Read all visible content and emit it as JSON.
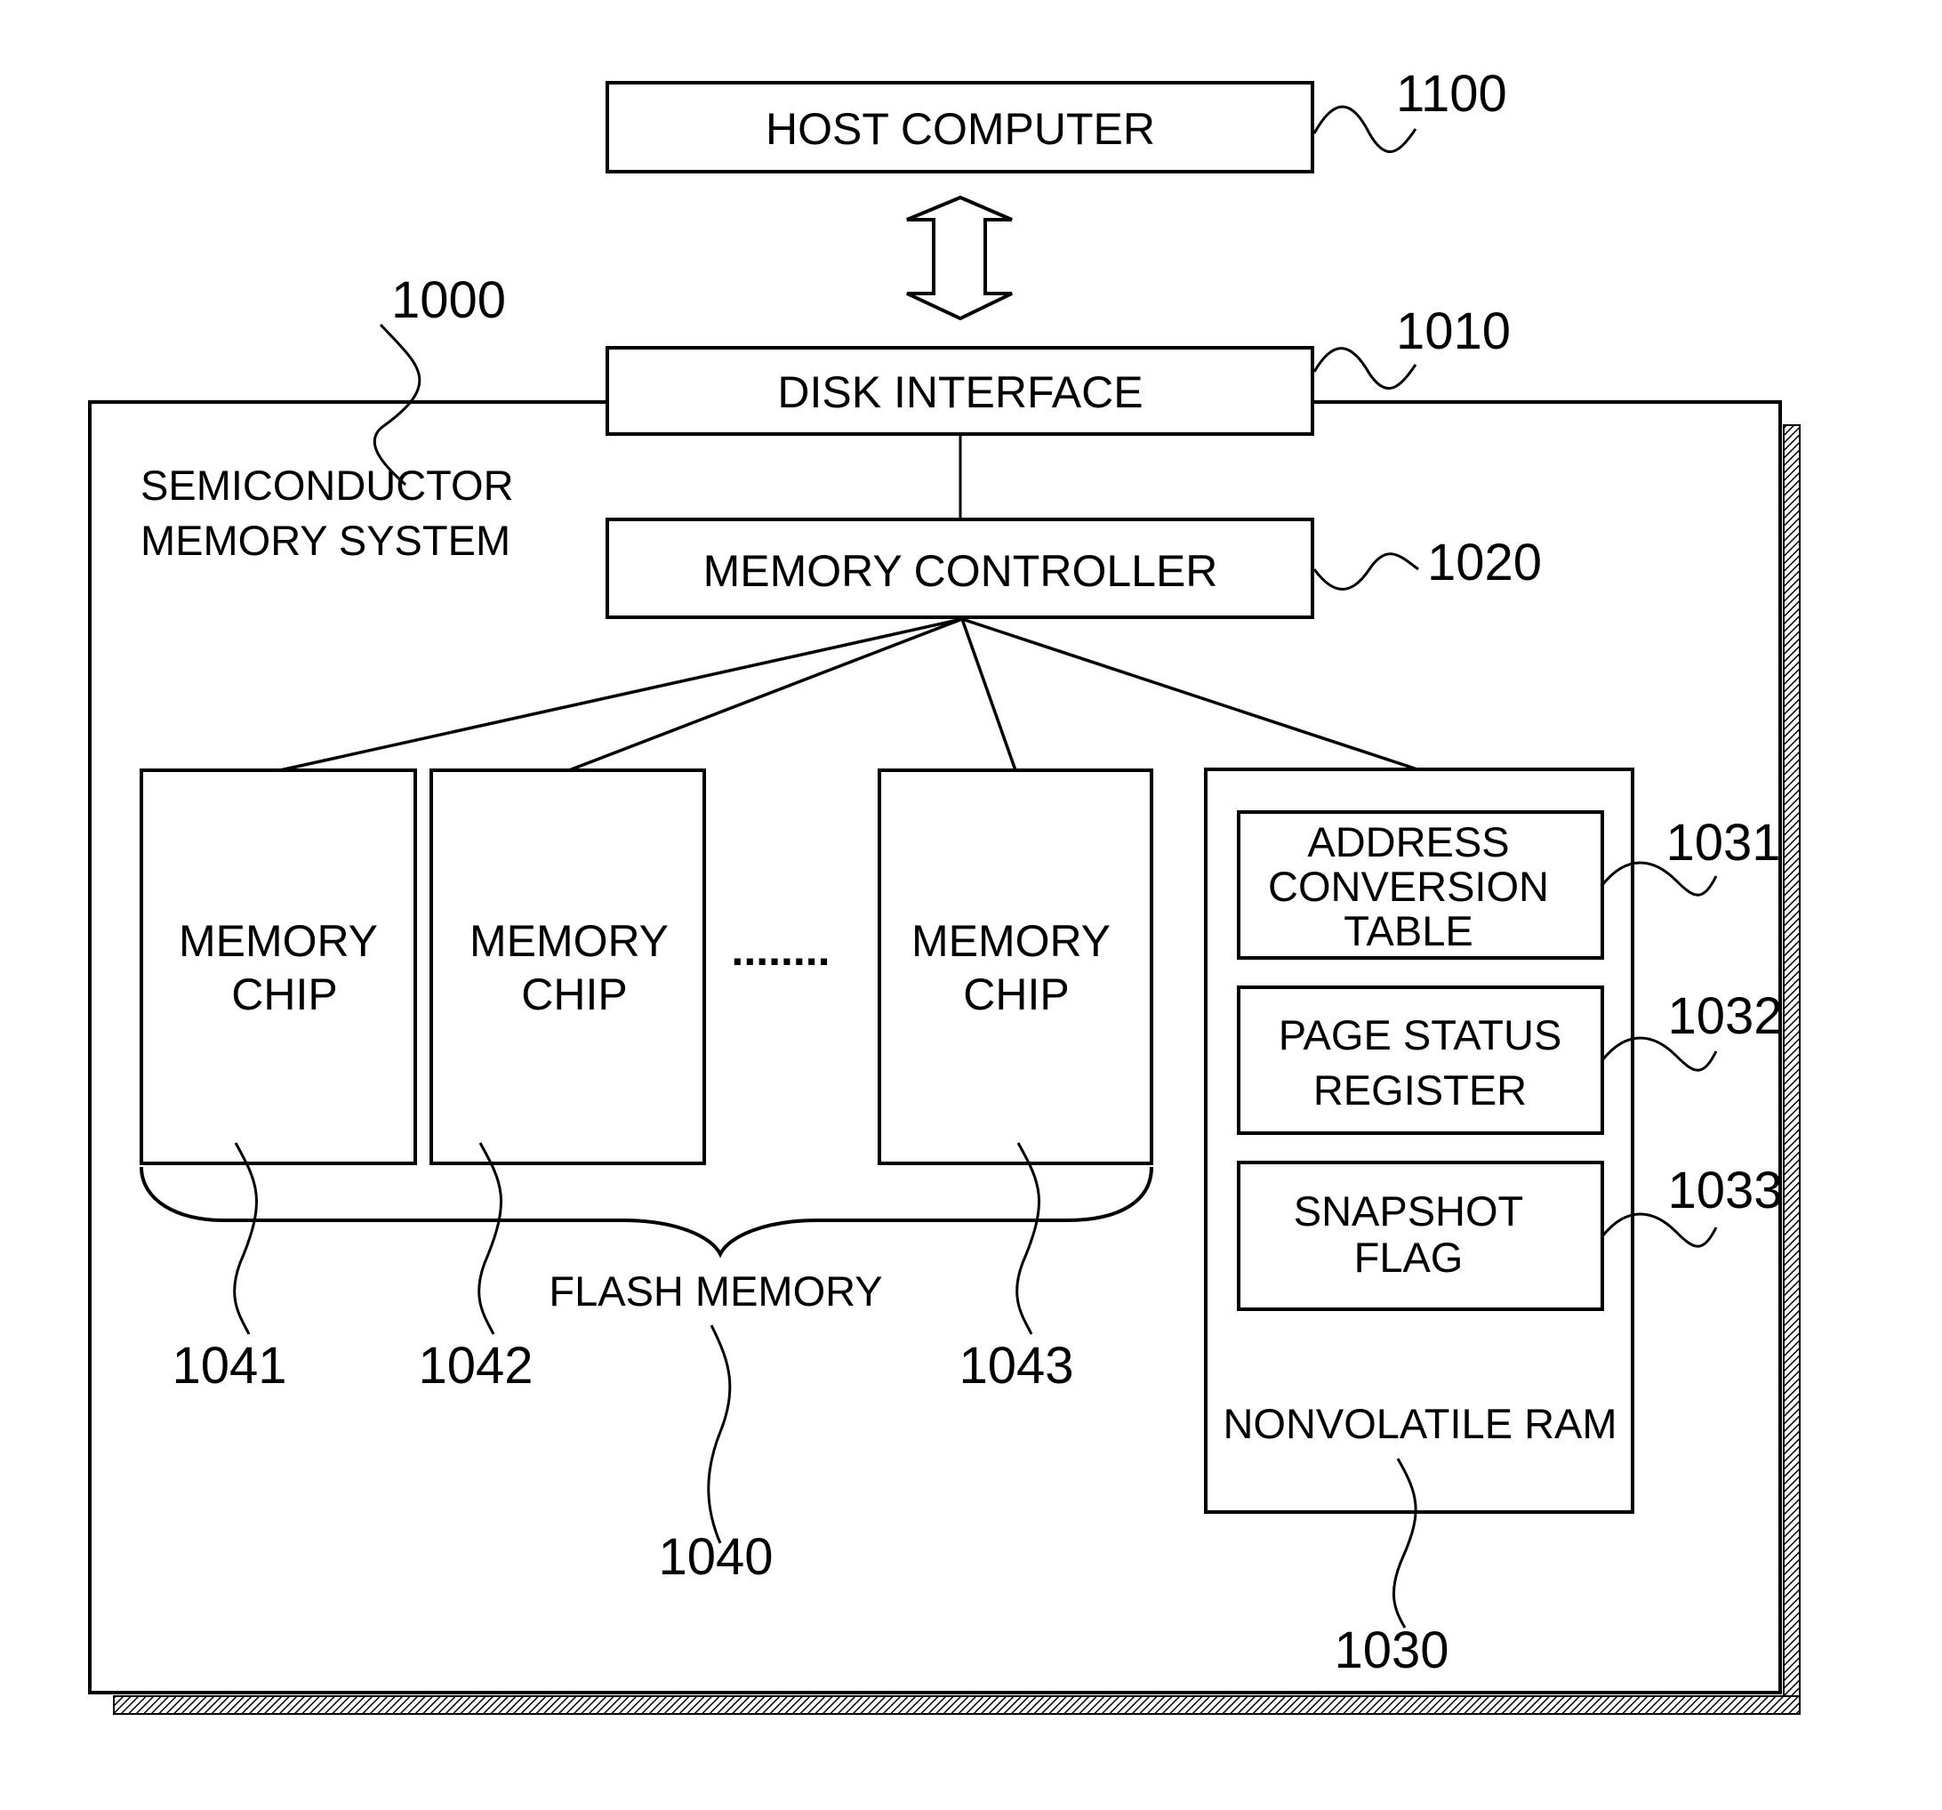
{
  "diagram": {
    "host": {
      "label": "HOST COMPUTER",
      "ref": "1100"
    },
    "system": {
      "label_lines": [
        "SEMICONDUCTOR",
        "MEMORY SYSTEM"
      ],
      "ref": "1000"
    },
    "disk_interface": {
      "label": "DISK INTERFACE",
      "ref": "1010"
    },
    "memory_controller": {
      "label": "MEMORY CONTROLLER",
      "ref": "1020"
    },
    "flash_memory": {
      "label": "FLASH MEMORY",
      "ref": "1040",
      "chips": [
        {
          "label_lines": [
            "MEMORY",
            "CHIP"
          ],
          "ref": "1041"
        },
        {
          "label_lines": [
            "MEMORY",
            "CHIP"
          ],
          "ref": "1042"
        },
        {
          "label_lines": [
            "MEMORY",
            "CHIP"
          ],
          "ref": "1043"
        }
      ],
      "ellipsis": "........"
    },
    "nonvolatile_ram": {
      "label": "NONVOLATILE RAM",
      "ref": "1030",
      "items": [
        {
          "label_lines": [
            "ADDRESS",
            "CONVERSION",
            "TABLE"
          ],
          "ref": "1031"
        },
        {
          "label_lines": [
            "PAGE STATUS",
            "REGISTER"
          ],
          "ref": "1032"
        },
        {
          "label_lines": [
            "SNAPSHOT",
            "FLAG"
          ],
          "ref": "1033"
        }
      ]
    }
  }
}
